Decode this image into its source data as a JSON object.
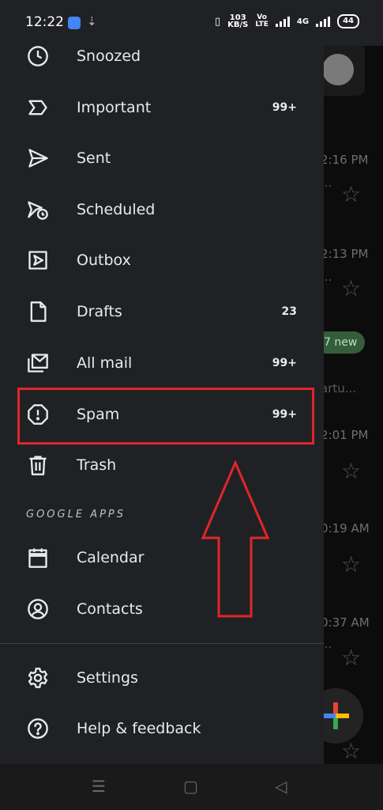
{
  "status_bar": {
    "time": "12:22",
    "speed_top": "103",
    "speed_bottom": "KB/S",
    "volte_top": "Vo",
    "volte_bottom": "LTE",
    "network": "4G",
    "battery": "44"
  },
  "background_list": {
    "times": [
      "2:16 PM",
      "2:13 PM",
      "2:01 PM",
      "0:19 AM",
      "0:37 AM"
    ],
    "chip": "7 new",
    "snippet_1": "...",
    "snippet_2": "...",
    "snippet_3": "artu...",
    "snippet_4": "..."
  },
  "drawer": {
    "items": [
      {
        "label": "Snoozed",
        "count": "",
        "icon": "clock-icon"
      },
      {
        "label": "Important",
        "count": "99+",
        "icon": "important-icon"
      },
      {
        "label": "Sent",
        "count": "",
        "icon": "send-icon"
      },
      {
        "label": "Scheduled",
        "count": "",
        "icon": "scheduled-icon"
      },
      {
        "label": "Outbox",
        "count": "",
        "icon": "outbox-icon"
      },
      {
        "label": "Drafts",
        "count": "23",
        "icon": "draft-icon"
      },
      {
        "label": "All mail",
        "count": "99+",
        "icon": "all-mail-icon"
      },
      {
        "label": "Spam",
        "count": "99+",
        "icon": "spam-icon"
      },
      {
        "label": "Trash",
        "count": "",
        "icon": "trash-icon"
      }
    ],
    "section_label": "GOOGLE APPS",
    "apps": [
      {
        "label": "Calendar",
        "icon": "calendar-icon"
      },
      {
        "label": "Contacts",
        "icon": "contacts-icon"
      }
    ],
    "footer": [
      {
        "label": "Settings",
        "icon": "gear-icon"
      },
      {
        "label": "Help & feedback",
        "icon": "help-icon"
      }
    ]
  },
  "colors": {
    "drawer_bg": "#202124",
    "highlight": "#e0262b",
    "text": "#e8eaed"
  }
}
